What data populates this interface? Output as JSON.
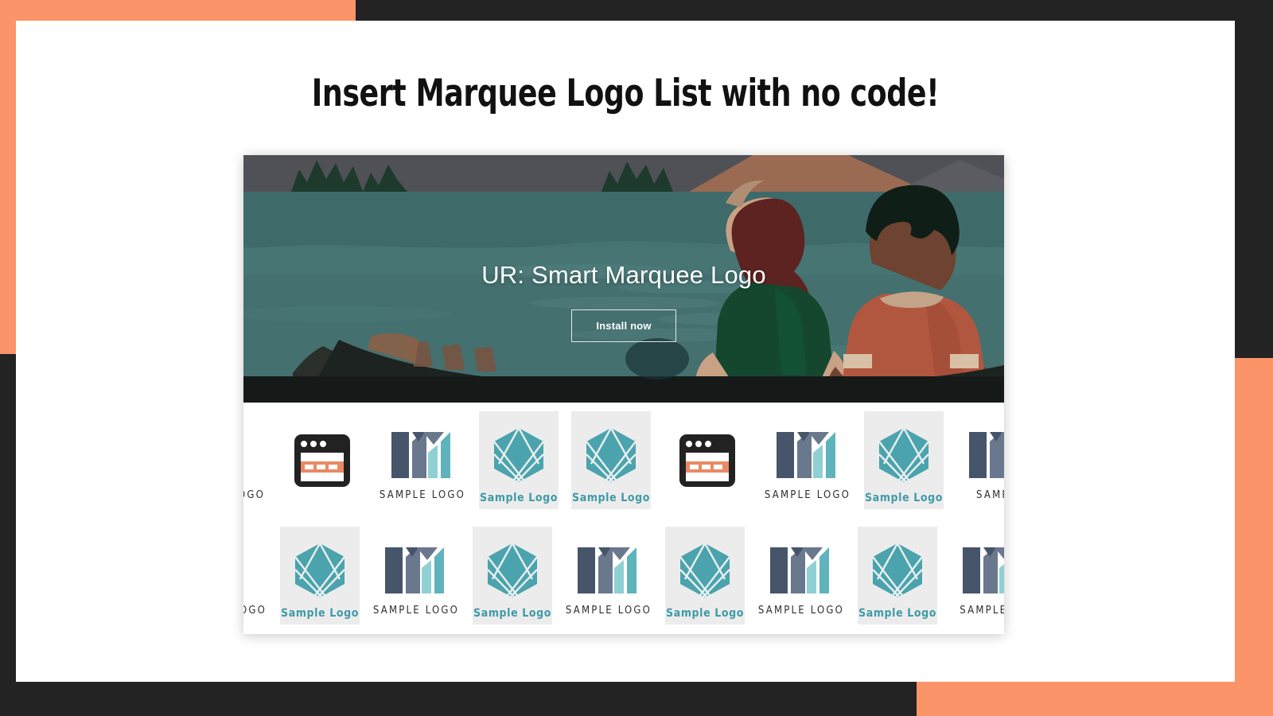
{
  "page": {
    "title": "Insert Marquee Logo List with no code!",
    "accent_color": "#fb9469",
    "frame_color": "#232323",
    "card_color": "#ffffff"
  },
  "hero": {
    "title": "UR: Smart Marquee Logo",
    "button_label": "Install now",
    "illustration": "canoe-lake-illustration",
    "colors": {
      "water": "#3f6b6b",
      "water_light": "#4b7a79",
      "mountain": "#4f5156",
      "pine": "#1d3a2c",
      "cliff": "#9a6a52",
      "boat": "#1c2320",
      "shirt_green": "#15472f",
      "shirt_rust": "#b2573f",
      "hair_auburn": "#5c2320",
      "hair_dark": "#0f1f17",
      "skin_light": "#c9a184",
      "skin_dark": "#6e4331"
    }
  },
  "marquee": {
    "row1": [
      {
        "mark": "bars-logo",
        "caption": "Sample LOGO",
        "style": "plain"
      },
      {
        "mark": "browser-window-logo",
        "caption": "",
        "style": "plain"
      },
      {
        "mark": "m-bars-logo",
        "caption": "Sample LOGO",
        "style": "plain"
      },
      {
        "mark": "hexagon-logo",
        "caption": "Sample Logo",
        "style": "tile"
      },
      {
        "mark": "hexagon-logo",
        "caption": "Sample Logo",
        "style": "tile"
      },
      {
        "mark": "browser-window-logo",
        "caption": "",
        "style": "plain"
      },
      {
        "mark": "m-bars-logo",
        "caption": "Sample LOGO",
        "style": "plain"
      },
      {
        "mark": "hexagon-logo",
        "caption": "Sample Logo",
        "style": "tile"
      },
      {
        "mark": "m-bars-logo",
        "caption": "Sample",
        "style": "plain"
      }
    ],
    "row2": [
      {
        "mark": "bars-logo",
        "caption": "Sample LOGO",
        "style": "plain"
      },
      {
        "mark": "hexagon-logo",
        "caption": "Sample Logo",
        "style": "tile"
      },
      {
        "mark": "m-bars-logo",
        "caption": "Sample LOGO",
        "style": "plain"
      },
      {
        "mark": "hexagon-logo",
        "caption": "Sample Logo",
        "style": "tile"
      },
      {
        "mark": "m-bars-logo",
        "caption": "Sample LOGO",
        "style": "plain"
      },
      {
        "mark": "hexagon-logo",
        "caption": "Sample Logo",
        "style": "tile"
      },
      {
        "mark": "m-bars-logo",
        "caption": "Sample LOGO",
        "style": "plain"
      },
      {
        "mark": "hexagon-logo",
        "caption": "Sample Logo",
        "style": "tile"
      },
      {
        "mark": "m-bars-logo",
        "caption": "Sample LO",
        "style": "plain"
      }
    ],
    "colors": {
      "teal": "#5fb3bd",
      "teal_dark": "#3f9aa8",
      "hex_teal": "#4ba3ad",
      "slate": "#47556b",
      "slate_mid": "#69788c",
      "tile_bg": "#ececec",
      "window_dark": "#222222",
      "window_accent": "#e98a63"
    }
  }
}
